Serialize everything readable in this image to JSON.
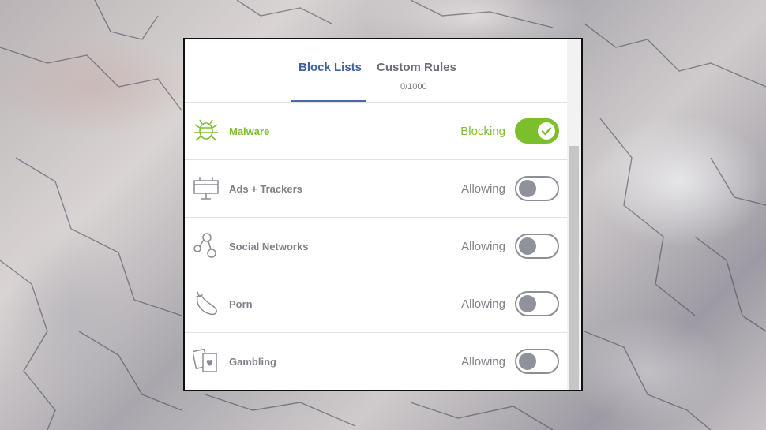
{
  "tabs": [
    {
      "label": "Block Lists",
      "active": true
    },
    {
      "label": "Custom Rules",
      "active": false,
      "count": "0/1000"
    }
  ],
  "lists": [
    {
      "name": "Malware",
      "status": "Blocking",
      "enabled": true,
      "icon": "bug-icon"
    },
    {
      "name": "Ads + Trackers",
      "status": "Allowing",
      "enabled": false,
      "icon": "billboard-icon"
    },
    {
      "name": "Social Networks",
      "status": "Allowing",
      "enabled": false,
      "icon": "network-nodes-icon"
    },
    {
      "name": "Porn",
      "status": "Allowing",
      "enabled": false,
      "icon": "eggplant-icon"
    },
    {
      "name": "Gambling",
      "status": "Allowing",
      "enabled": false,
      "icon": "playing-cards-icon"
    }
  ],
  "colors": {
    "accent_active_tab": "#3f5fa8",
    "blocking_green": "#7cbf2c",
    "muted_gray": "#7f8189"
  }
}
